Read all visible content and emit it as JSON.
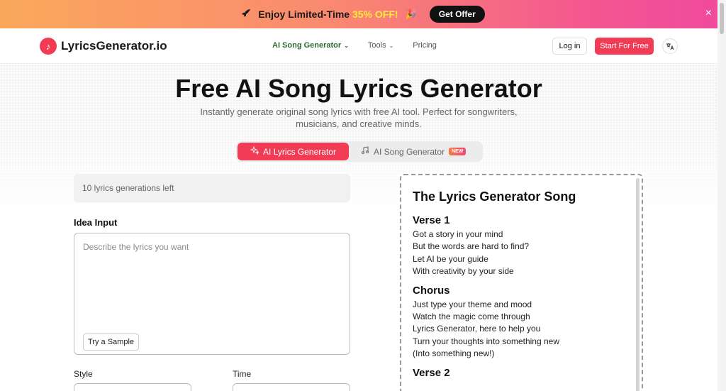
{
  "promo": {
    "text": "Enjoy Limited-Time ",
    "highlight": "35% OFF!",
    "offer_button": "Get Offer",
    "close_icon": "×"
  },
  "header": {
    "logo_text": "LyricsGenerator.io",
    "nav": [
      {
        "label": "AI Song Generator",
        "has_dropdown": true
      },
      {
        "label": "Tools",
        "has_dropdown": true
      },
      {
        "label": "Pricing",
        "has_dropdown": false
      }
    ],
    "login_label": "Log in",
    "start_label": "Start For Free",
    "lang_icon": "translate-icon"
  },
  "hero": {
    "title": "Free AI Song Lyrics Generator",
    "subtitle": "Instantly generate original song lyrics with free AI tool. Perfect for songwriters, musicians, and creative minds."
  },
  "tabs": [
    {
      "label": "AI Lyrics Generator",
      "active": true
    },
    {
      "label": "AI Song Generator",
      "badge": "NEW",
      "active": false
    }
  ],
  "form": {
    "generations_left": "10 lyrics generations left",
    "idea_label": "Idea Input",
    "idea_placeholder": "Describe the lyrics you want",
    "sample_button": "Try a Sample",
    "style_label": "Style",
    "time_label": "Time"
  },
  "lyrics": {
    "song_title": "The Lyrics Generator Song",
    "sections": [
      {
        "title": "Verse 1",
        "lines": [
          "Got a story in your mind",
          "But the words are hard to find?",
          "Let AI be your guide",
          "With creativity by your side"
        ]
      },
      {
        "title": "Chorus",
        "lines": [
          "Just type your theme and mood",
          "Watch the magic come through",
          "Lyrics Generator, here to help you",
          "Turn your thoughts into something new",
          "(Into something new!)"
        ]
      },
      {
        "title": "Verse 2",
        "lines": []
      }
    ]
  },
  "colors": {
    "accent": "#f23b55",
    "promo_highlight": "#ffeb3b",
    "nav_active": "#2e6b2e"
  }
}
